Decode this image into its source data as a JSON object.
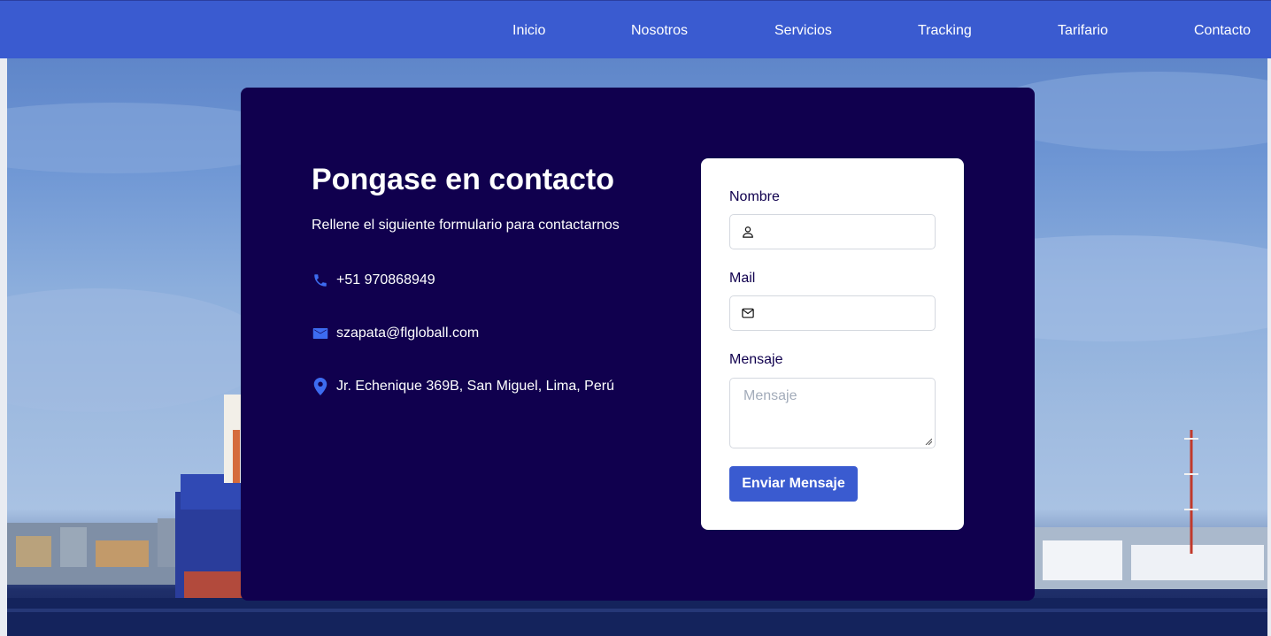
{
  "nav": {
    "items": [
      "Inicio",
      "Nosotros",
      "Servicios",
      "Tracking",
      "Tarifario",
      "Contacto"
    ]
  },
  "contact": {
    "title": "Pongase en contacto",
    "subtitle": "Rellene el siguiente formulario para contactarnos",
    "phone": "+51 970868949",
    "email": "szapata@flgloball.com",
    "address": "Jr. Echenique 369B, San Miguel, Lima, Perú"
  },
  "form": {
    "name_label": "Nombre",
    "name_value": "",
    "mail_label": "Mail",
    "mail_value": "",
    "message_label": "Mensaje",
    "message_placeholder": "Mensaje",
    "submit_label": "Enviar Mensaje"
  },
  "icons": {
    "phone": "phone-icon",
    "email": "envelope-icon",
    "address": "map-pin-icon",
    "name_input": "user-icon",
    "mail_input": "mail-icon"
  },
  "colors": {
    "primary": "#3a5bd0",
    "card_bg": "#10004e",
    "icon_accent": "#3d6cf0",
    "form_bg": "#ffffff"
  }
}
